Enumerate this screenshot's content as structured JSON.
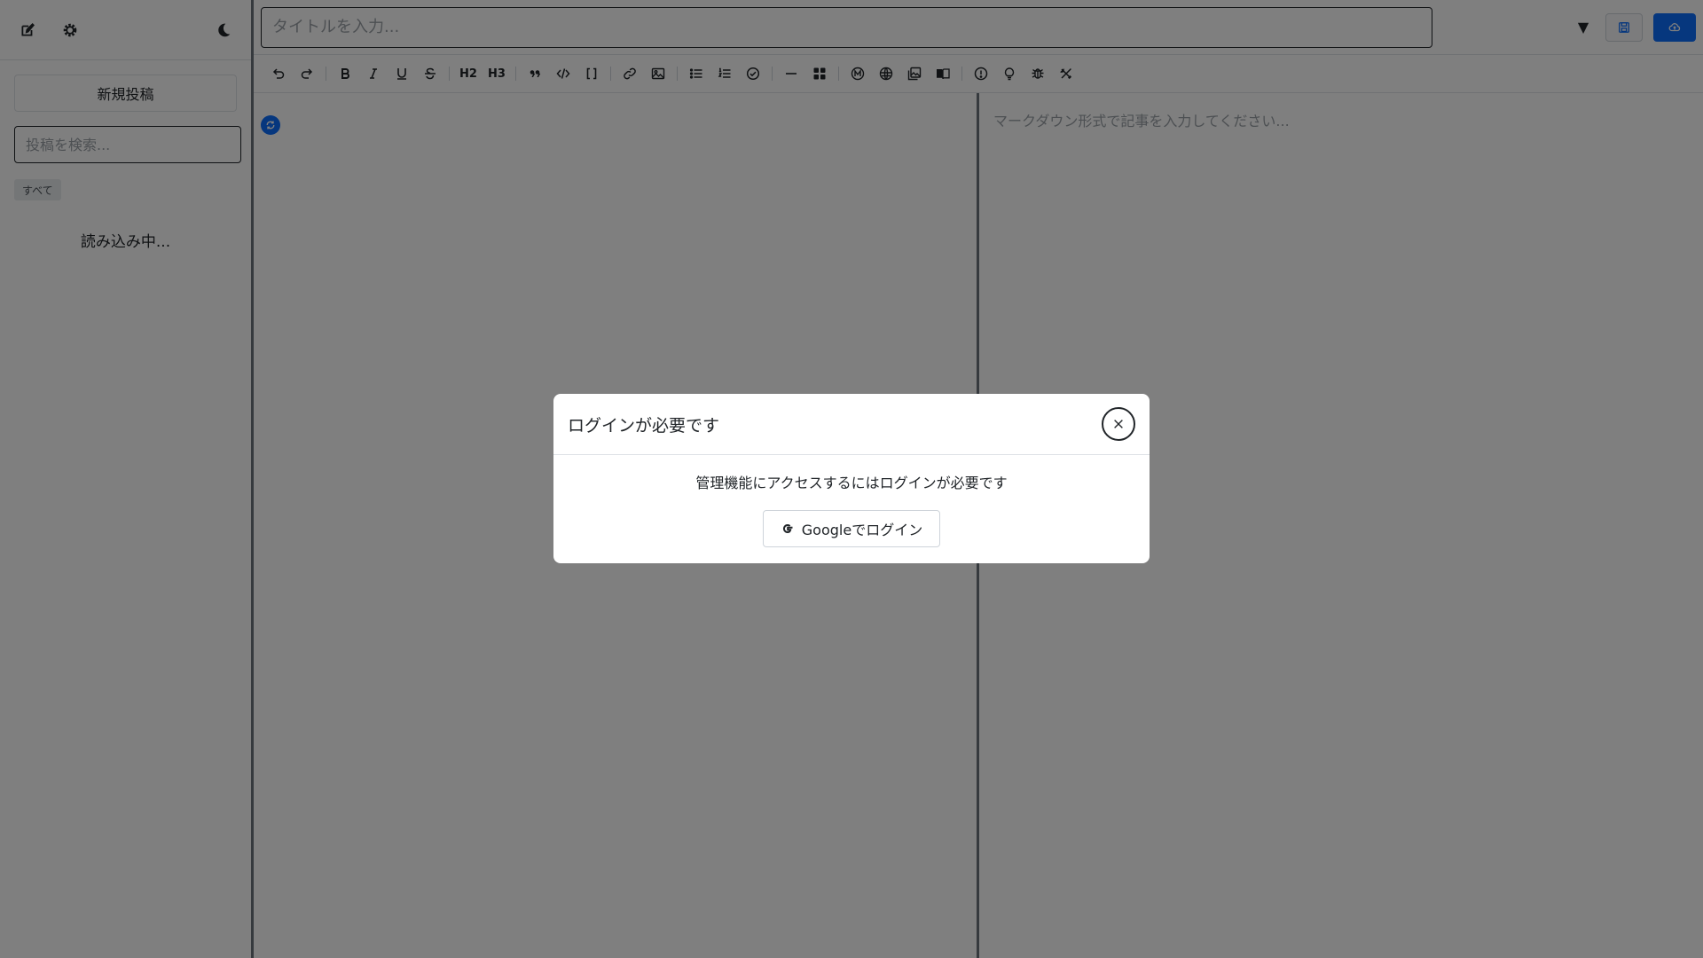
{
  "sidebar": {
    "new_post_label": "新規投稿",
    "search_placeholder": "投稿を検索...",
    "filter_all_label": "すべて",
    "loading_text": "読み込み中..."
  },
  "editor": {
    "title_placeholder": "タイトルを入力...",
    "body_placeholder": "マークダウン形式で記事を入力してください...",
    "dropdown_caret": "▼"
  },
  "toolbar": {
    "h2_label": "H2",
    "h3_label": "H3"
  },
  "modal": {
    "title": "ログインが必要です",
    "message": "管理機能にアクセスするにはログインが必要です",
    "google_button_label": "Googleでログイン"
  },
  "icons": {
    "sidebar": [
      "edit-icon",
      "gear-icon",
      "moon-icon"
    ],
    "topbar": [
      "chevron-down-icon",
      "save-draft-icon",
      "cloud-upload-icon"
    ],
    "toolbar": [
      "undo-icon",
      "redo-icon",
      "bold-icon",
      "italic-icon",
      "underline-icon",
      "strikethrough-icon",
      "quote-icon",
      "code-icon",
      "code-block-icon",
      "link-icon",
      "image-icon",
      "bullet-list-icon",
      "numbered-list-icon",
      "task-list-icon",
      "horizontal-rule-icon",
      "grid-icon",
      "m-icon",
      "globe-icon",
      "gallery-icon",
      "book-icon",
      "alert-icon",
      "lightbulb-icon",
      "bug-icon",
      "tools-icon"
    ]
  },
  "colors": {
    "accent": "#0d6efd",
    "overlay": "rgba(0,0,0,0.5)"
  }
}
